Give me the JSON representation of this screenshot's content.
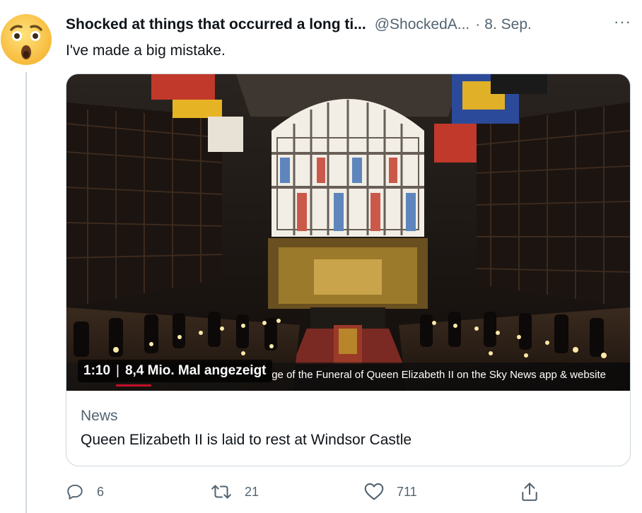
{
  "tweet": {
    "author_name": "Shocked at things that occurred a long ti...",
    "handle": "@ShockedA...",
    "separator": "·",
    "date": "8. Sep.",
    "more_label": "···",
    "text": "I've made a big mistake.",
    "avatar_icon": "astonished-face-emoji"
  },
  "card": {
    "media_icon": "video-thumbnail",
    "video_time": "1:10",
    "views": "8,4 Mio. Mal angezeigt",
    "ticker_text": "ge of the Funeral of Queen Elizabeth II on the Sky News app & website",
    "source": "News",
    "title": "Queen Elizabeth II is laid to rest at Windsor Castle"
  },
  "actions": {
    "reply_count": "6",
    "retweet_count": "21",
    "like_count": "711",
    "reply_icon": "reply-icon",
    "retweet_icon": "retweet-icon",
    "like_icon": "heart-icon",
    "share_icon": "share-icon"
  },
  "colors": {
    "text_primary": "#0f1419",
    "text_secondary": "#536471",
    "border": "#cfd9de",
    "ticker_accent": "#c4102c"
  }
}
